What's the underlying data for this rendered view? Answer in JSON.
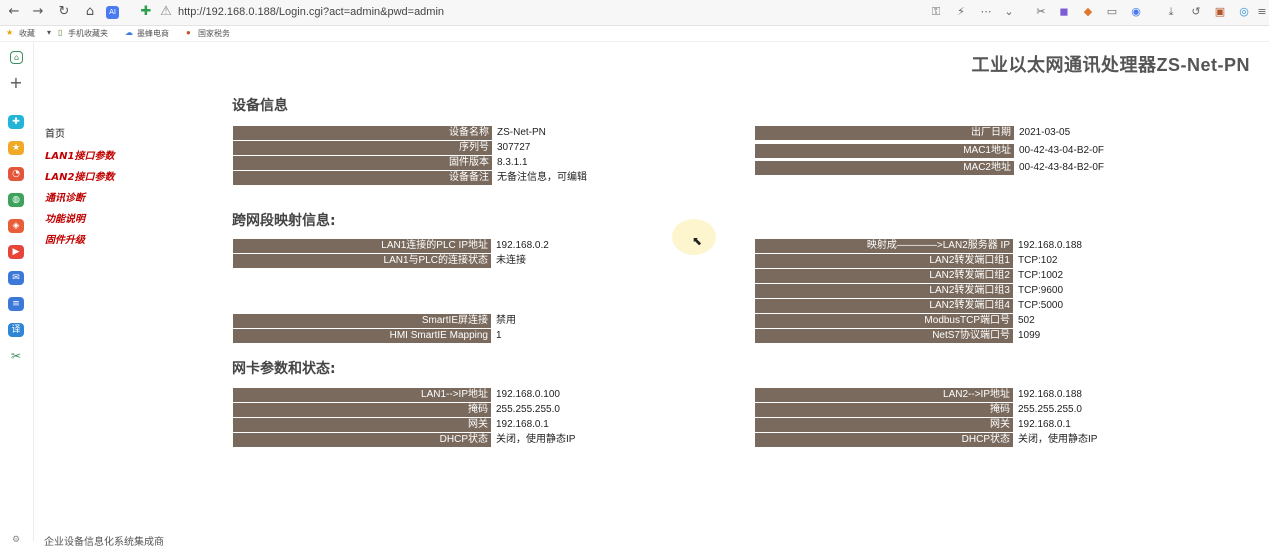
{
  "browser": {
    "url": "http://192.168.0.188/Login.cgi?act=admin&pwd=admin",
    "bookmarks": [
      "收藏",
      "手机收藏夹",
      "墨蜂电商",
      "国家税务"
    ]
  },
  "header": {
    "title": "工业以太网通讯处理器ZS-Net-PN"
  },
  "menu": [
    "首页",
    "LAN1接口参数",
    "LAN2接口参数",
    "通讯诊断",
    "功能说明",
    "固件升级"
  ],
  "sections": {
    "device": {
      "title": "设备信息",
      "left": [
        {
          "label": "设备名称",
          "value": "ZS-Net-PN"
        },
        {
          "label": "序列号",
          "value": "307727"
        },
        {
          "label": "固件版本",
          "value": "8.3.1.1"
        },
        {
          "label": "设备备注",
          "value": "无备注信息，可编辑"
        }
      ],
      "right": [
        {
          "label": "出厂日期",
          "value": "2021-03-05"
        },
        {
          "label": "MAC1地址",
          "value": "00-42-43-04-B2-0F"
        },
        {
          "label": "MAC2地址",
          "value": "00-42-43-84-B2-0F"
        }
      ]
    },
    "mapping": {
      "title": "跨网段映射信息:",
      "left": [
        {
          "label": "LAN1连接的PLC IP地址",
          "value": "192.168.0.2"
        },
        {
          "label": "LAN1与PLC的连接状态",
          "value": "未连接"
        }
      ],
      "left2": [
        {
          "label": "SmartIE屏连接",
          "value": "禁用"
        },
        {
          "label": "HMI SmartIE Mapping",
          "value": "1"
        }
      ],
      "right": [
        {
          "label": "映射成————>LAN2服务器 IP",
          "value": "192.168.0.188"
        },
        {
          "label": "LAN2转发端口组1",
          "value": "TCP:102"
        },
        {
          "label": "LAN2转发端口组2",
          "value": "TCP:1002"
        },
        {
          "label": "LAN2转发端口组3",
          "value": "TCP:9600"
        },
        {
          "label": "LAN2转发端口组4",
          "value": "TCP:5000"
        },
        {
          "label": "ModbusTCP端口号",
          "value": "502"
        },
        {
          "label": "NetS7协议端口号",
          "value": "1099"
        }
      ]
    },
    "nic": {
      "title": "网卡参数和状态:",
      "left": [
        {
          "label": "LAN1-->IP地址",
          "value": "192.168.0.100"
        },
        {
          "label": "掩码",
          "value": "255.255.255.0"
        },
        {
          "label": "网关",
          "value": "192.168.0.1"
        },
        {
          "label": "DHCP状态",
          "value": "关闭，使用静态IP"
        }
      ],
      "right": [
        {
          "label": "LAN2-->IP地址",
          "value": "192.168.0.188"
        },
        {
          "label": "掩码",
          "value": "255.255.255.0"
        },
        {
          "label": "网关",
          "value": "192.168.0.1"
        },
        {
          "label": "DHCP状态",
          "value": "关闭，使用静态IP"
        }
      ]
    }
  },
  "footer": {
    "text": "企业设备信息化系统集成商"
  }
}
